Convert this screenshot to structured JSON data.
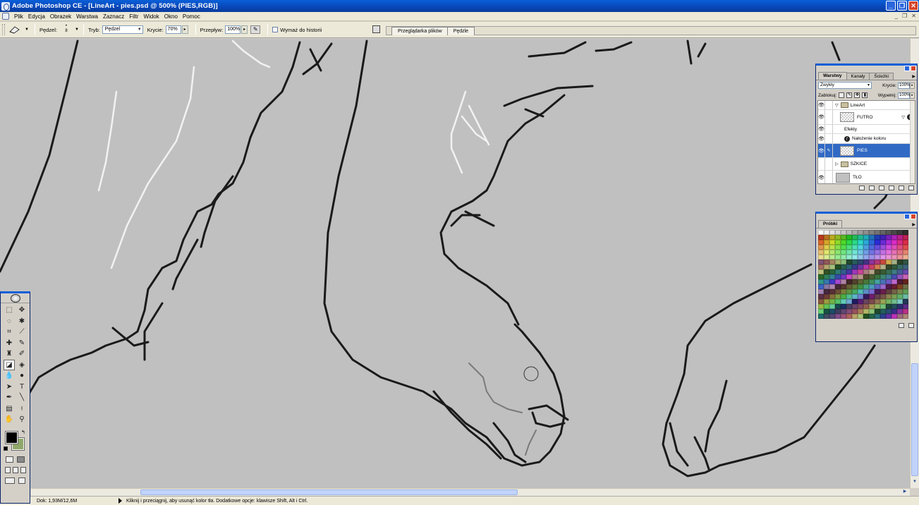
{
  "window": {
    "title": "Adobe Photoshop CE - [LineArt - pies.psd @ 500% (PIES,RGB)]"
  },
  "menu": {
    "items": [
      "Plik",
      "Edycja",
      "Obrazek",
      "Warstwa",
      "Zaznacz",
      "Filtr",
      "Widok",
      "Okno",
      "Pomoc"
    ]
  },
  "options": {
    "brush_label": "Pędzel:",
    "brush_size": "8",
    "mode_label": "Tryb:",
    "mode_value": "Pędzel",
    "opacity_label": "Krycie:",
    "opacity_value": "70%",
    "flow_label": "Przepływ:",
    "flow_value": "100%",
    "erase_history_label": "Wymaż do historii",
    "palette_tabs": [
      "Przeglądarka plików",
      "Pędzle"
    ]
  },
  "status": {
    "doc_size": "Dok: 1,93M/12,6M",
    "hint": "Kliknij i przeciągnij, aby usunąć kolor tła. Dodatkowe opcje: klawisze Shift, Alt i Ctrl."
  },
  "layers_panel": {
    "tabs": [
      "Warstwy",
      "Kanały",
      "Ścieżki"
    ],
    "blend_mode": "Zwykły",
    "opacity_label": "Krycie:",
    "opacity_value": "100%",
    "lock_label": "Zablokuj:",
    "fill_label": "Wypełnij:",
    "fill_value": "100%",
    "layers": [
      {
        "name": "LineArt",
        "kind": "group"
      },
      {
        "name": "FUTRO",
        "kind": "layer"
      },
      {
        "name": "Efekty",
        "kind": "effects"
      },
      {
        "name": "Nałożenie koloru",
        "kind": "effect"
      },
      {
        "name": "PIES",
        "kind": "layer",
        "selected": true
      },
      {
        "name": "SZKICE",
        "kind": "group"
      },
      {
        "name": "TŁO",
        "kind": "layer"
      }
    ]
  },
  "swatches_panel": {
    "tab": "Próbki"
  },
  "toolbox": {
    "foreground_color": "#000000",
    "background_color": "#8fa86a"
  },
  "colors": {
    "canvas": "#c0c0c0",
    "titlebar": "#0a5fd8",
    "selection": "#316ac5"
  }
}
